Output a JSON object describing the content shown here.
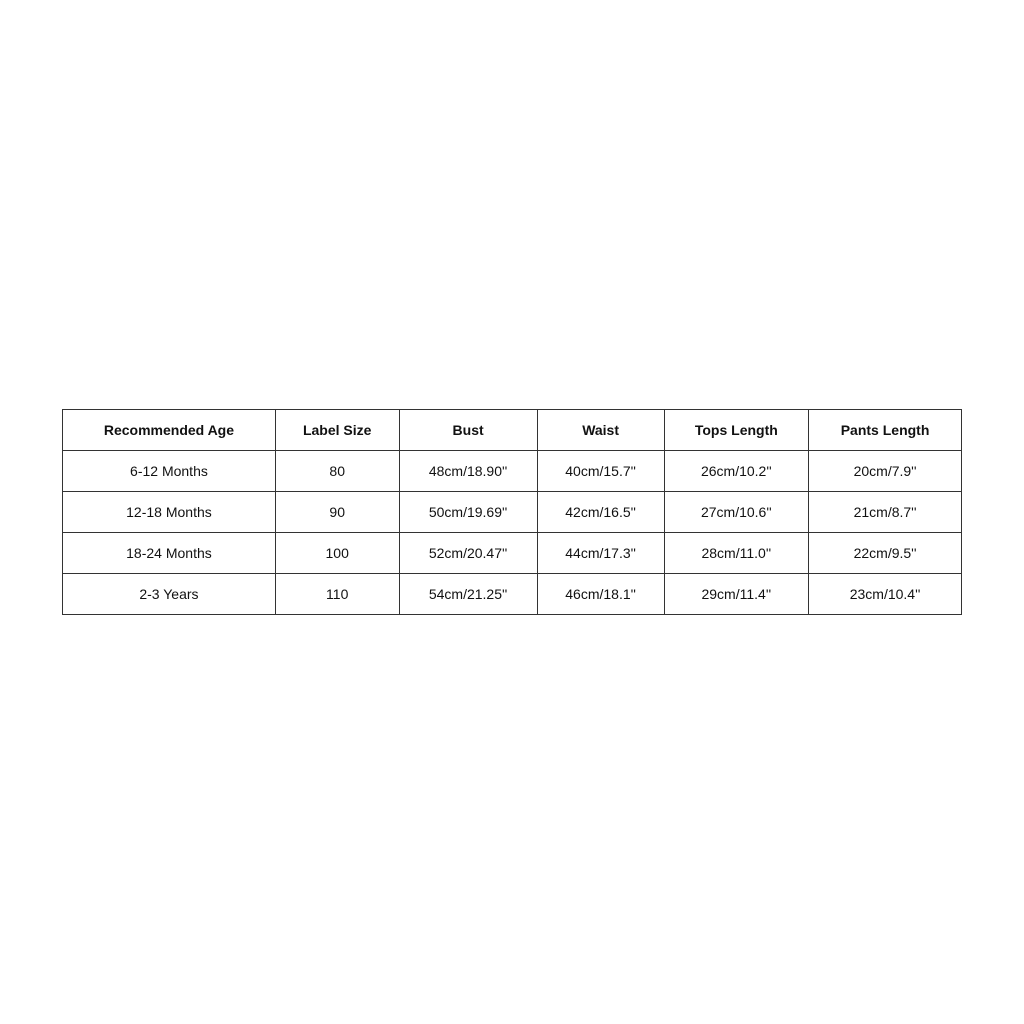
{
  "table": {
    "headers": [
      "Recommended Age",
      "Label Size",
      "Bust",
      "Waist",
      "Tops Length",
      "Pants Length"
    ],
    "rows": [
      {
        "age": "6-12 Months",
        "label_size": "80",
        "bust": "48cm/18.90''",
        "waist": "40cm/15.7''",
        "tops_length": "26cm/10.2''",
        "pants_length": "20cm/7.9''"
      },
      {
        "age": "12-18 Months",
        "label_size": "90",
        "bust": "50cm/19.69''",
        "waist": "42cm/16.5''",
        "tops_length": "27cm/10.6''",
        "pants_length": "21cm/8.7''"
      },
      {
        "age": "18-24 Months",
        "label_size": "100",
        "bust": "52cm/20.47''",
        "waist": "44cm/17.3''",
        "tops_length": "28cm/11.0''",
        "pants_length": "22cm/9.5''"
      },
      {
        "age": "2-3 Years",
        "label_size": "110",
        "bust": "54cm/21.25''",
        "waist": "46cm/18.1''",
        "tops_length": "29cm/11.4''",
        "pants_length": "23cm/10.4''"
      }
    ]
  }
}
